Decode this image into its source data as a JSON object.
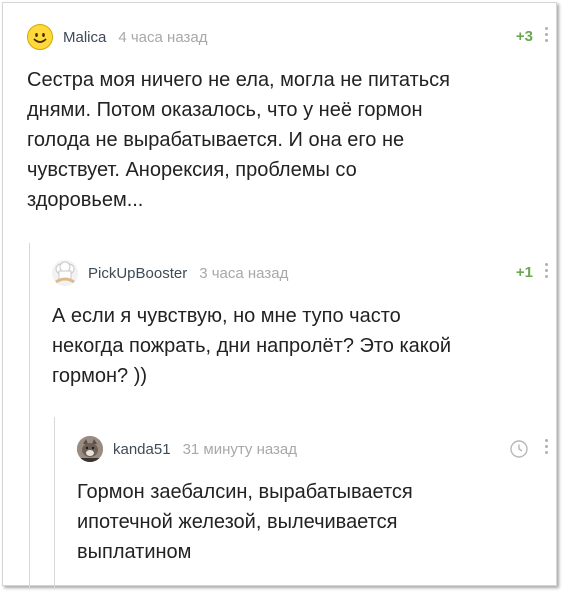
{
  "comments": [
    {
      "author": "Malica",
      "time": "4 часа назад",
      "rating": "+3",
      "avatar_icon": "smiley-face-icon",
      "text": "Сестра моя ничего не ела, могла не питаться\nднями. Потом оказалось, что у неё гормон\nголода не вырабатывается. И она его не\nчувствует. Анорексия, проблемы со\nздоровьем..."
    },
    {
      "author": "PickUpBooster",
      "time": "3 часа назад",
      "rating": "+1",
      "avatar_icon": "chef-hat-icon",
      "text": "А если я чувствую, но мне тупо часто\nнекогда пожрать, дни напролёт? Это какой\nгормон? ))"
    },
    {
      "author": "kanda51",
      "time": "31 минуту назад",
      "avatar_icon": "cat-photo-icon",
      "text": "Гормон заебалсин, вырабатывается\nипотечной железой, вылечивается\nвыплатином"
    }
  ],
  "colors": {
    "author": "#3d4a57",
    "time": "#a8a8a8",
    "rating": "#6aa84f",
    "thread_line": "#d8d8d8"
  }
}
